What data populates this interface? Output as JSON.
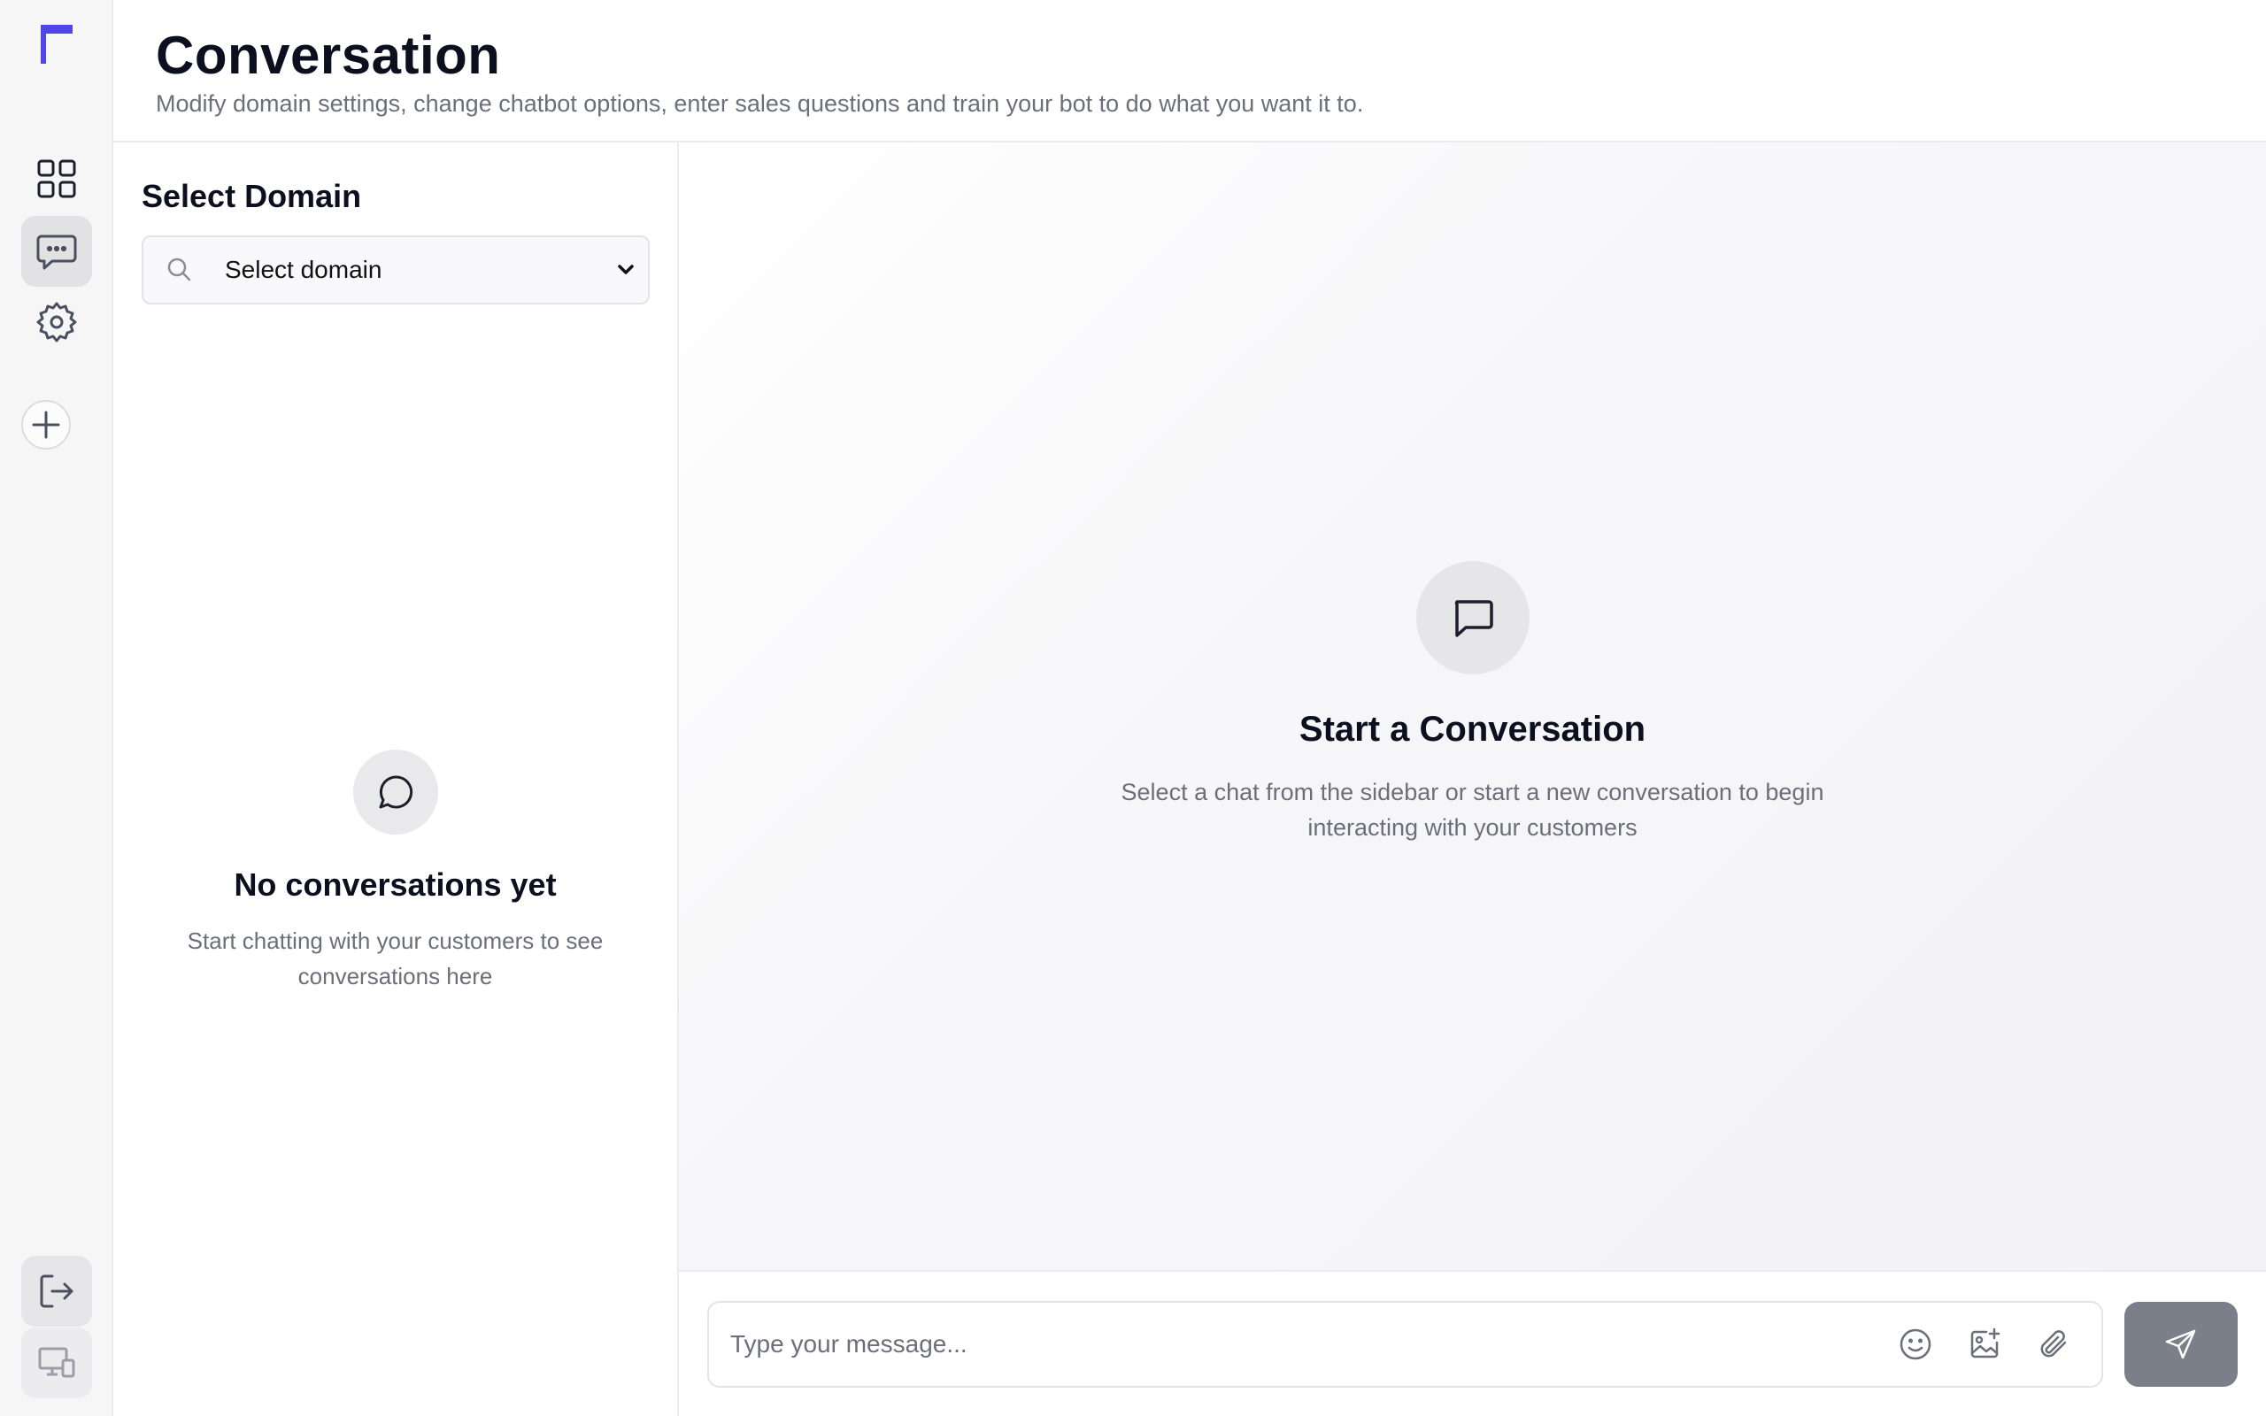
{
  "header": {
    "title": "Conversation",
    "subtitle": "Modify domain settings, change chatbot options, enter sales questions and train your bot to do what you want it to."
  },
  "domain": {
    "label": "Select Domain",
    "selected": "Select domain"
  },
  "conversations": {
    "empty_title": "No conversations yet",
    "empty_text": "Start chatting with your customers to see conversations here",
    "items": []
  },
  "chat": {
    "empty_title": "Start a Conversation",
    "empty_text": "Select a chat from the sidebar or start a new conversation to begin interacting with your customers",
    "input_placeholder": "Type your message..."
  },
  "colors": {
    "brand": "#4f46e5",
    "send_button": "#7b7f89",
    "rail_background": "#f6f6f7"
  },
  "icons": {
    "rail": [
      "logo-flag-icon",
      "dashboard-grid-icon",
      "chat-bubble-icon",
      "settings-gear-icon",
      "add-icon",
      "logout-icon",
      "devices-icon"
    ],
    "composer": [
      "emoji-icon",
      "image-add-icon",
      "paperclip-icon",
      "send-icon"
    ]
  }
}
